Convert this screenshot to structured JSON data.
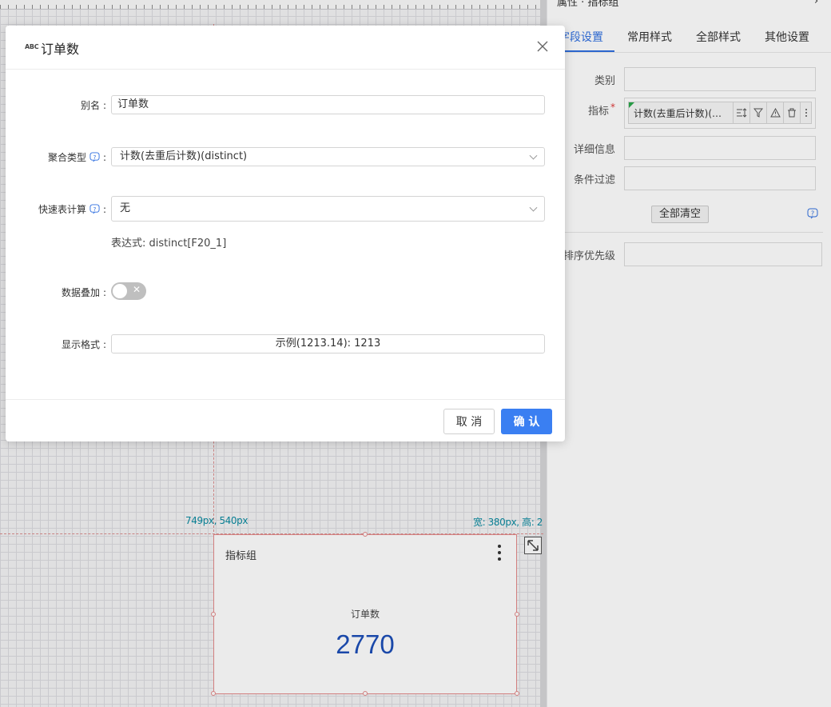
{
  "panel": {
    "header_fragment": "属性 · 指标组",
    "tabs": [
      {
        "label": "字段设置",
        "active": true
      },
      {
        "label": "常用样式"
      },
      {
        "label": "全部样式"
      },
      {
        "label": "其他设置"
      }
    ],
    "fields": {
      "category": "类别",
      "metric": "指标",
      "metric_value": "计数(去重后计数)(…",
      "detail": "详细信息",
      "filter": "条件过滤",
      "sort_priority": "排序优先级"
    },
    "clear_all": "全部清空"
  },
  "canvas": {
    "coord_left": "749px, 540px",
    "coord_right": "宽: 380px, 高: 2",
    "widget": {
      "title": "指标组",
      "metric_name": "订单数",
      "metric_value": "2770"
    }
  },
  "dialog": {
    "icon_text": "ABC",
    "title": "订单数",
    "alias_label": "别名",
    "alias_value": "订单数",
    "agg_label": "聚合类型",
    "agg_value": "计数(去重后计数)(distinct)",
    "quick_calc_label": "快速表计算",
    "quick_calc_value": "无",
    "expression": "表达式: distinct[F20_1]",
    "stack_label": "数据叠加",
    "stack_enabled": false,
    "format_label": "显示格式",
    "format_value": "示例(1213.14): 1213",
    "cancel": "取 消",
    "ok": "确 认"
  },
  "colors": {
    "accent": "#3a7ff2",
    "metric_value": "#1d4fb8",
    "tab_active": "#2f6fe0"
  }
}
